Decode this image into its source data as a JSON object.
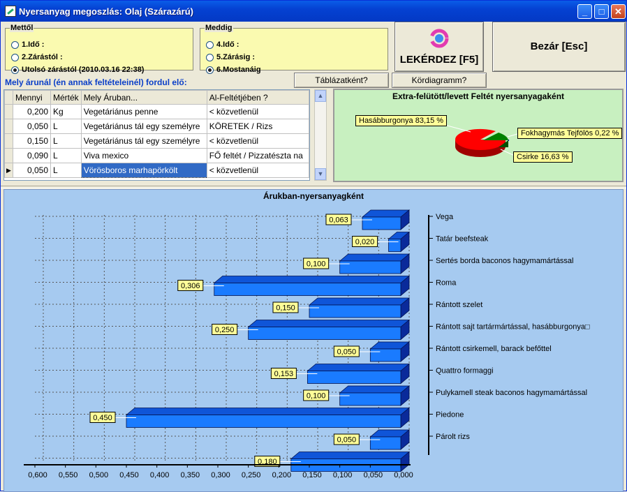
{
  "window": {
    "title": "Nyersanyag megoszlás: Olaj  (Szárazárú)"
  },
  "from_group": {
    "legend": "Mettől",
    "options": [
      {
        "label": "1.Idő :",
        "selected": false
      },
      {
        "label": "2.Zárástól :",
        "selected": false
      },
      {
        "label": "Utolsó zárástól (2010.03.16 22:38)",
        "selected": true
      }
    ]
  },
  "to_group": {
    "legend": "Meddig",
    "options": [
      {
        "label": "4.Idő :",
        "selected": false
      },
      {
        "label": "5.Zárásig :",
        "selected": false
      },
      {
        "label": "6.Mostanáig",
        "selected": true
      }
    ]
  },
  "buttons": {
    "query": "LEKÉRDEZ [F5]",
    "close": "Bezár [Esc]",
    "as_table": "Táblázatként?",
    "pie_chart": "Kördiagramm?"
  },
  "question": "Mely árunál (én annak feltételeinél) fordul elő:",
  "table": {
    "headers": [
      "Mennyi",
      "Mérték",
      "Mely Áruban...",
      "Al-Feltétjében ?"
    ],
    "rows": [
      [
        "0,200",
        "Kg",
        "Vegetáriánus penne",
        " < közvetlenül"
      ],
      [
        "0,050",
        "L",
        "Vegetáriánus tál egy személyre",
        "KÖRETEK / Rizs"
      ],
      [
        "0,150",
        "L",
        "Vegetáriánus tál egy személyre",
        " < közvetlenül"
      ],
      [
        "0,090",
        "L",
        "Viva mexico",
        "FŐ feltét / Pizzatészta na"
      ],
      [
        "0,050",
        "L",
        "Vörösboros marhapörkölt",
        " < közvetlenül"
      ]
    ],
    "current_row": 4
  },
  "pie": {
    "title": "Extra-felütött/levett Feltét nyersanyagaként",
    "colors": {
      "hasab": "#ff0000",
      "csirke": "#008000",
      "fokhagymas": "#0000c0"
    },
    "slice_labels": [
      "Hasábburgonya 83,15 %",
      "Csirke 16,63 %",
      "Fokhagymás Tejfölös 0,22 %"
    ]
  },
  "chart_data": {
    "type": "bar",
    "title": "Árukban-nyersanyagként",
    "orientation": "horizontal-reversed",
    "categories": [
      "Vega",
      "Tatár beefsteak",
      "Sertés borda baconos hagymamártással",
      "Roma",
      "Rántott szelet",
      "Rántott sajt tartármártással, hasábburgonya□",
      "Rántott csirkemell, barack befőttel",
      "Quattro formaggi",
      "Pulykamell steak baconos hagymamártással",
      "Piedone",
      "Párolt rizs",
      ""
    ],
    "values": [
      0.063,
      0.02,
      0.1,
      0.306,
      0.15,
      0.25,
      0.05,
      0.153,
      0.1,
      0.45,
      0.05,
      0.18
    ],
    "value_labels": [
      "0,063",
      "0,020",
      "0,100",
      "0,306",
      "0,150",
      "0,250",
      "0,050",
      "0,153",
      "0,100",
      "0,450",
      "0,050",
      "0,180"
    ],
    "x_ticks": [
      "0,600",
      "0,550",
      "0,500",
      "0,450",
      "0,400",
      "0,350",
      "0,300",
      "0,250",
      "0,200",
      "0,150",
      "0,100",
      "0,050",
      "0,000"
    ],
    "xlim": [
      0,
      0.6
    ],
    "bar_color": "#1a7bff",
    "bar_dark": "#0a2a9a"
  }
}
